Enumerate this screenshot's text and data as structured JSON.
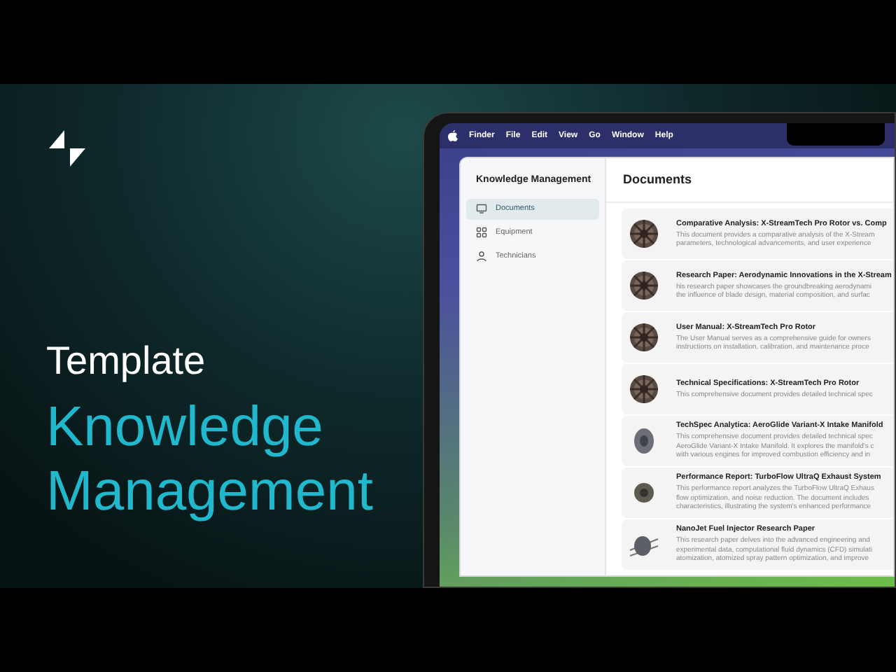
{
  "hero": {
    "subtitle": "Template",
    "title_lines": [
      "Knowledge",
      "Management"
    ]
  },
  "menu_bar": {
    "items": [
      "Finder",
      "File",
      "Edit",
      "View",
      "Go",
      "Window",
      "Help"
    ]
  },
  "sidebar": {
    "title": "Knowledge Management",
    "items": [
      {
        "label": "Documents",
        "kind": "monitor",
        "selected": true
      },
      {
        "label": "Equipment",
        "kind": "grid",
        "selected": false
      },
      {
        "label": "Technicians",
        "kind": "user",
        "selected": false
      }
    ]
  },
  "content": {
    "heading": "Documents",
    "documents": [
      {
        "kind": "rotor",
        "title": "Comparative Analysis: X-StreamTech Pro Rotor vs. Comp",
        "lines": [
          "This document provides a comparative analysis of the X-Stream",
          "parameters, technological advancements, and user experience"
        ]
      },
      {
        "kind": "rotor",
        "title": "Research Paper: Aerodynamic Innovations in the X-Stream",
        "lines": [
          "his research paper showcases the groundbreaking aerodynami",
          "the influence of blade design, material composition, and surfac"
        ]
      },
      {
        "kind": "rotor",
        "title": "User Manual: X-StreamTech Pro Rotor",
        "lines": [
          "The User Manual serves as a comprehensive guide for owners",
          "instructions on installation, calibration, and maintenance proce"
        ]
      },
      {
        "kind": "rotor",
        "title": "Technical Specifications: X-StreamTech Pro Rotor",
        "lines": [
          "This comprehensive document provides detailed technical spec"
        ]
      },
      {
        "kind": "manifold",
        "title": "TechSpec Analytica: AeroGlide Variant-X Intake Manifold",
        "lines": [
          "This comprehensive document provides detailed technical spec",
          "AeroGlide Variant-X Intake Manifold. It explores the manifold's c",
          "with various engines for improved combustion efficiency and in"
        ]
      },
      {
        "kind": "exhaust",
        "title": "Performance Report: TurboFlow UltraQ Exhaust System",
        "lines": [
          "This performance report analyzes the TurboFlow UltraQ Exhaus",
          "flow optimization, and noise reduction. The document includes",
          "characteristics, illustrating the system's enhanced performance"
        ]
      },
      {
        "kind": "injector",
        "title": "NanoJet Fuel Injector Research Paper",
        "lines": [
          "This research paper delves into the advanced engineering and",
          "experimental data, computational fluid dynamics (CFD) simulati",
          "atomization, atomized spray pattern optimization, and improve"
        ]
      }
    ]
  }
}
